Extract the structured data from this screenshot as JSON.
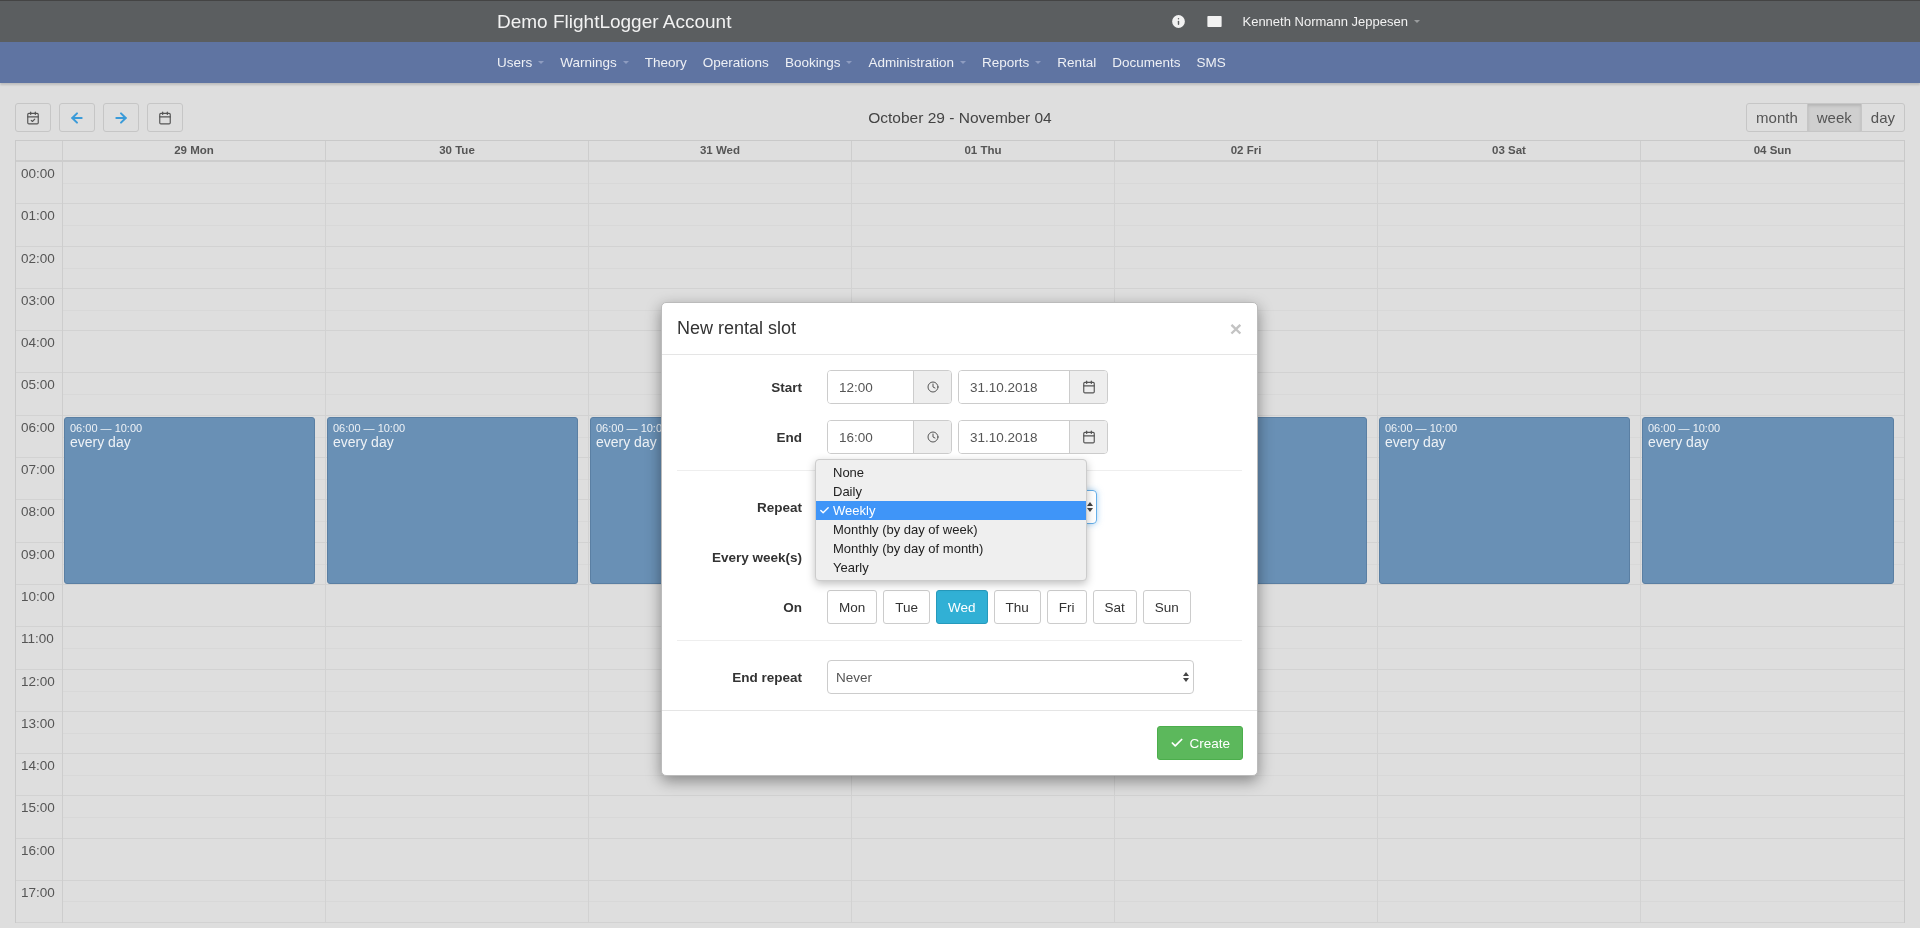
{
  "header": {
    "title": "Demo FlightLogger Account",
    "user": "Kenneth Normann Jeppesen"
  },
  "nav": [
    {
      "label": "Users",
      "dropdown": true
    },
    {
      "label": "Warnings",
      "dropdown": true
    },
    {
      "label": "Theory",
      "dropdown": false
    },
    {
      "label": "Operations",
      "dropdown": false
    },
    {
      "label": "Bookings",
      "dropdown": true
    },
    {
      "label": "Administration",
      "dropdown": true
    },
    {
      "label": "Reports",
      "dropdown": true
    },
    {
      "label": "Rental",
      "dropdown": false
    },
    {
      "label": "Documents",
      "dropdown": false
    },
    {
      "label": "SMS",
      "dropdown": false
    }
  ],
  "calendar": {
    "range": "October 29 - November 04",
    "views": [
      {
        "label": "month",
        "selected": false
      },
      {
        "label": "week",
        "selected": true
      },
      {
        "label": "day",
        "selected": false
      }
    ],
    "days": [
      {
        "label": "29 Mon",
        "event": true,
        "event_time": "06:00 — 10:00",
        "event_title": "every day"
      },
      {
        "label": "30 Tue",
        "event": true,
        "event_time": "06:00 — 10:00",
        "event_title": "every day"
      },
      {
        "label": "31 Wed",
        "event": true,
        "event_time": "06:00 — 10:0",
        "event_title": "every day"
      },
      {
        "label": "01 Thu"
      },
      {
        "label": "02 Fri",
        "event": true
      },
      {
        "label": "03 Sat",
        "event": true,
        "event_time": "06:00 — 10:00",
        "event_title": "every day"
      },
      {
        "label": "04 Sun",
        "event": true,
        "event_time": "06:00 — 10:00",
        "event_title": "every day"
      }
    ],
    "hours": [
      "00:00",
      "01:00",
      "02:00",
      "03:00",
      "04:00",
      "05:00",
      "06:00",
      "07:00",
      "08:00",
      "09:00",
      "10:00",
      "11:00",
      "12:00",
      "13:00",
      "14:00",
      "15:00",
      "16:00",
      "17:00"
    ]
  },
  "modal": {
    "title": "New rental slot",
    "close": "×",
    "start": {
      "label": "Start",
      "time": "12:00",
      "date": "31.10.2018"
    },
    "end": {
      "label": "End",
      "time": "16:00",
      "date": "31.10.2018"
    },
    "repeat": {
      "label": "Repeat",
      "options": [
        {
          "label": "None",
          "selected": false
        },
        {
          "label": "Daily",
          "selected": false
        },
        {
          "label": "Weekly",
          "selected": true
        },
        {
          "label": "Monthly (by day of week)",
          "selected": false
        },
        {
          "label": "Monthly (by day of month)",
          "selected": false
        },
        {
          "label": "Yearly",
          "selected": false
        }
      ]
    },
    "every_label": "Every week(s)",
    "on": {
      "label": "On",
      "days": [
        {
          "label": "Mon",
          "selected": false
        },
        {
          "label": "Tue",
          "selected": false
        },
        {
          "label": "Wed",
          "selected": true
        },
        {
          "label": "Thu",
          "selected": false
        },
        {
          "label": "Fri",
          "selected": false
        },
        {
          "label": "Sat",
          "selected": false
        },
        {
          "label": "Sun",
          "selected": false
        }
      ]
    },
    "end_repeat": {
      "label": "End repeat",
      "value": "Never"
    },
    "create": "Create"
  }
}
